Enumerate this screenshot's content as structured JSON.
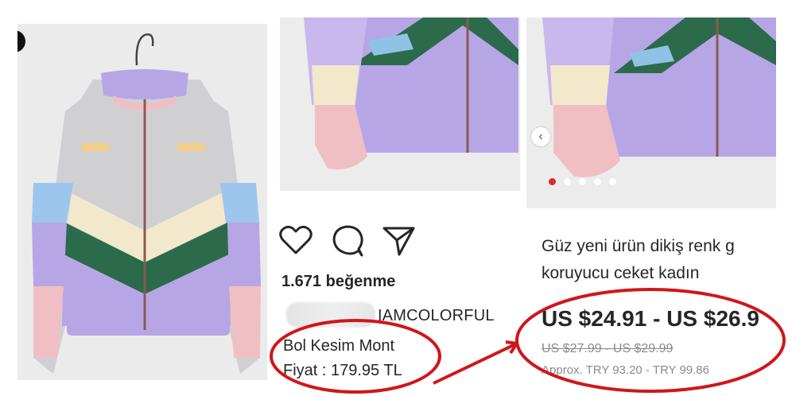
{
  "instagram": {
    "likes": "1.671 beğenme",
    "username": "IAMCOLORFUL",
    "caption_line1": "Bol Kesim Mont",
    "caption_line2": "Fiyat : 179.95 TL"
  },
  "product": {
    "title_line1": "Güz yeni ürün dikiş renk g",
    "title_line2": "koruyucu ceket kadın",
    "price": "US $24.91 - US $26.9",
    "old_price": "US $27.99 - US $29.99",
    "approx": "Approx. TRY 93.20 - TRY 99.86"
  },
  "icons": [
    "heart-icon",
    "comment-icon",
    "share-icon",
    "chevron-left-icon",
    "hanger-icon"
  ],
  "colors": {
    "highlight_red": "#d0161b",
    "carousel_active": "#e02020",
    "text": "#262626"
  }
}
